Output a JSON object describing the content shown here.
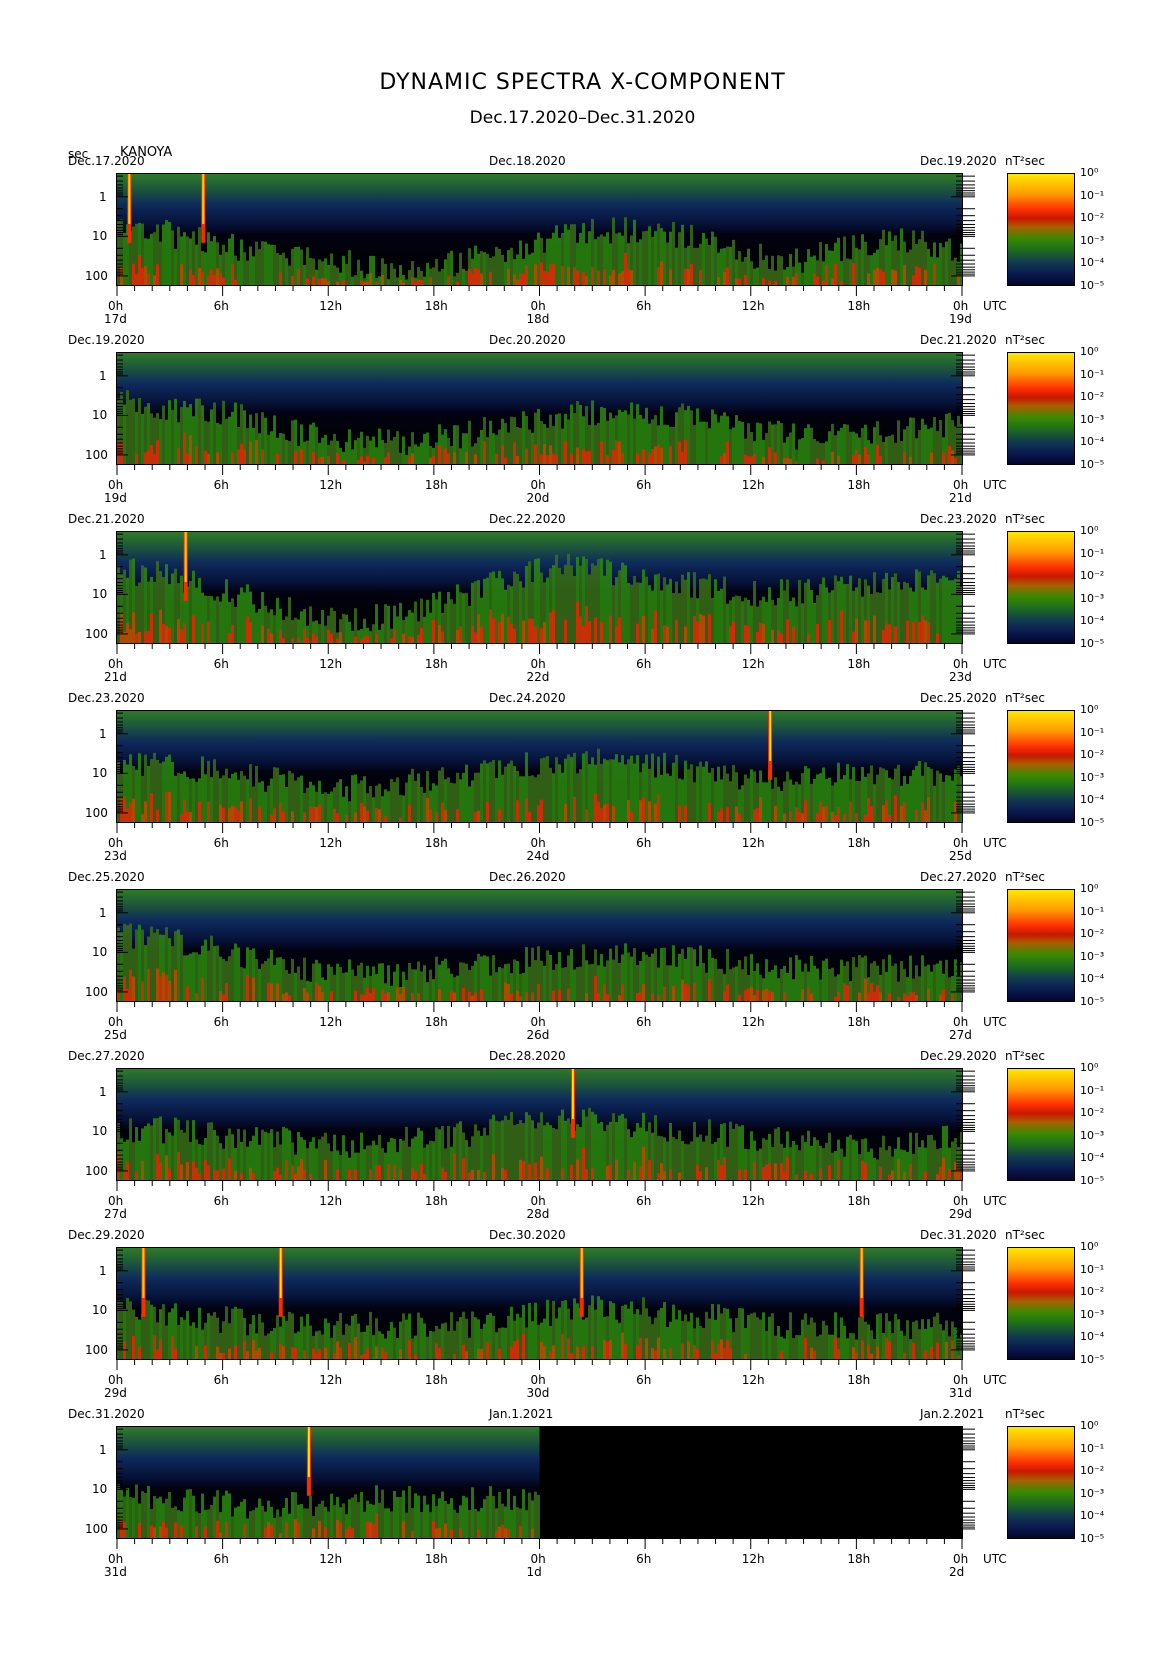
{
  "title": "DYNAMIC SPECTRA X-COMPONENT",
  "subtitle": "Dec.17.2020–Dec.31.2020",
  "yaxis_unit": "sec",
  "station": "KANOYA",
  "colorbar_unit": "nT²sec",
  "utc_label": "UTC",
  "chart_data": {
    "type": "heatmap",
    "title": "DYNAMIC SPECTRA X-COMPONENT",
    "ylabel": "sec",
    "y_scale": "log",
    "y_ticks": [
      "1",
      "10",
      "100"
    ],
    "x_ticks": [
      "0h",
      "6h",
      "12h",
      "18h",
      "0h",
      "6h",
      "12h",
      "18h",
      "0h"
    ],
    "colorbar": {
      "label": "nT²sec",
      "scale": "log",
      "ticks": [
        "10⁰",
        "10⁻¹",
        "10⁻²",
        "10⁻³",
        "10⁻⁴",
        "10⁻⁵"
      ],
      "colors": [
        "#ffe800",
        "#ff3000",
        "#3a8a00",
        "#1e6e1e",
        "#103a50",
        "#04062a"
      ]
    },
    "panels": [
      {
        "start_date": "Dec.17.2020",
        "mid_date": "Dec.18.2020",
        "end_date": "Dec.19.2020",
        "day_labels": [
          "17d",
          "18d",
          "19d"
        ],
        "spikes_hours": [
          0.7,
          4.9
        ],
        "activity": [
          0.55,
          0.45,
          0.35,
          0.25,
          0.2,
          0.15,
          0.2,
          0.3,
          0.45,
          0.5,
          0.45,
          0.3,
          0.2,
          0.35,
          0.4,
          0.3
        ],
        "data_end_hour": 48
      },
      {
        "start_date": "Dec.19.2020",
        "mid_date": "Dec.20.2020",
        "end_date": "Dec.21.2020",
        "day_labels": [
          "19d",
          "20d",
          "21d"
        ],
        "spikes_hours": [],
        "activity": [
          0.55,
          0.5,
          0.45,
          0.3,
          0.2,
          0.2,
          0.25,
          0.35,
          0.45,
          0.5,
          0.45,
          0.35,
          0.25,
          0.3,
          0.3,
          0.35
        ],
        "data_end_hour": 48
      },
      {
        "start_date": "Dec.21.2020",
        "mid_date": "Dec.22.2020",
        "end_date": "Dec.23.2020",
        "day_labels": [
          "21d",
          "22d",
          "23d"
        ],
        "spikes_hours": [
          3.9
        ],
        "activity": [
          0.65,
          0.6,
          0.45,
          0.3,
          0.2,
          0.25,
          0.4,
          0.6,
          0.7,
          0.6,
          0.55,
          0.45,
          0.45,
          0.5,
          0.55,
          0.55
        ],
        "data_end_hour": 48
      },
      {
        "start_date": "Dec.23.2020",
        "mid_date": "Dec.24.2020",
        "end_date": "Dec.25.2020",
        "day_labels": [
          "23d",
          "24d",
          "25d"
        ],
        "spikes_hours": [
          37.1
        ],
        "activity": [
          0.5,
          0.5,
          0.45,
          0.35,
          0.3,
          0.35,
          0.4,
          0.5,
          0.55,
          0.55,
          0.5,
          0.4,
          0.4,
          0.45,
          0.45,
          0.45
        ],
        "data_end_hour": 48
      },
      {
        "start_date": "Dec.25.2020",
        "mid_date": "Dec.26.2020",
        "end_date": "Dec.27.2020",
        "day_labels": [
          "25d",
          "26d",
          "27d"
        ],
        "spikes_hours": [],
        "activity": [
          0.6,
          0.55,
          0.45,
          0.3,
          0.25,
          0.25,
          0.3,
          0.35,
          0.4,
          0.45,
          0.4,
          0.35,
          0.3,
          0.3,
          0.3,
          0.3
        ],
        "data_end_hour": 48
      },
      {
        "start_date": "Dec.27.2020",
        "mid_date": "Dec.28.2020",
        "end_date": "Dec.29.2020",
        "day_labels": [
          "27d",
          "28d",
          "29d"
        ],
        "spikes_hours": [
          25.9
        ],
        "activity": [
          0.45,
          0.45,
          0.4,
          0.35,
          0.3,
          0.35,
          0.4,
          0.5,
          0.55,
          0.5,
          0.45,
          0.4,
          0.35,
          0.3,
          0.3,
          0.4
        ],
        "data_end_hour": 48
      },
      {
        "start_date": "Dec.29.2020",
        "mid_date": "Dec.30.2020",
        "end_date": "Dec.31.2020",
        "day_labels": [
          "29d",
          "30d",
          "31d"
        ],
        "spikes_hours": [
          1.5,
          9.3,
          26.4,
          42.3
        ],
        "activity": [
          0.45,
          0.4,
          0.35,
          0.3,
          0.3,
          0.3,
          0.3,
          0.35,
          0.45,
          0.45,
          0.4,
          0.35,
          0.3,
          0.3,
          0.3,
          0.3
        ],
        "data_end_hour": 48
      },
      {
        "start_date": "Dec.31.2020",
        "mid_date": "Jan.1.2021",
        "end_date": "Jan.2.2021",
        "day_labels": [
          "31d",
          "1d",
          "2d"
        ],
        "spikes_hours": [
          10.9
        ],
        "activity": [
          0.4,
          0.35,
          0.3,
          0.3,
          0.35,
          0.35,
          0.35,
          0.35
        ],
        "data_end_hour": 24
      }
    ]
  }
}
